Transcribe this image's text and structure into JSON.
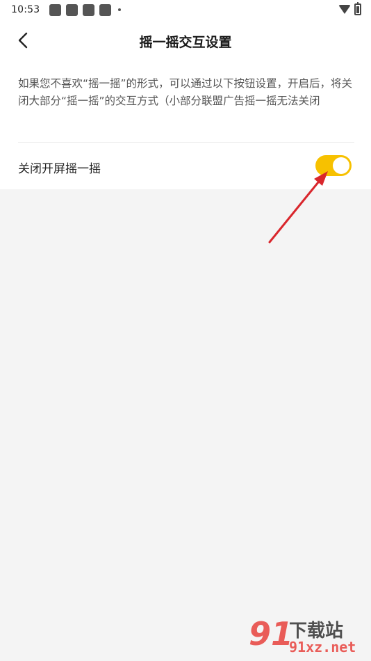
{
  "status_bar": {
    "time": "10:53"
  },
  "header": {
    "title": "摇一摇交互设置",
    "back_icon": "chevron-left-icon"
  },
  "description": "如果您不喜欢“摇一摇”的形式，可以通过以下按钮设置，开启后，将关闭大部分“摇一摇”的交互方式（小部分联盟广告摇一摇无法关闭",
  "setting": {
    "label": "关闭开屏摇一摇",
    "enabled": true,
    "toggle_color": "#f7c100"
  },
  "annotation": {
    "arrow_color": "#d9262c"
  },
  "watermark": {
    "logo": "91",
    "brand": "下载站",
    "domain": "91xz.net"
  }
}
